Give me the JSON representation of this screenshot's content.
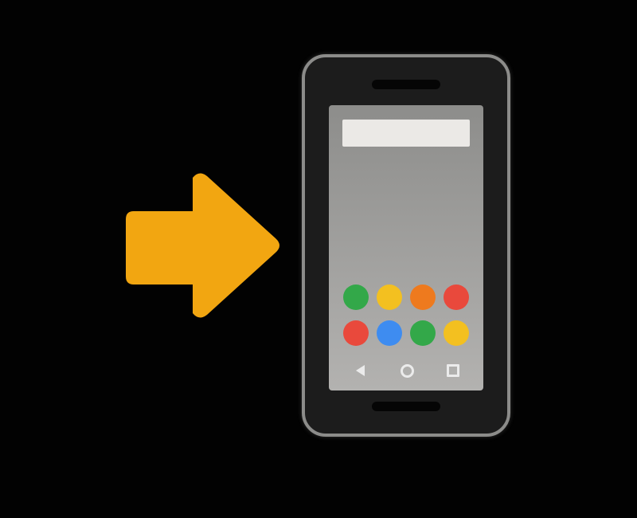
{
  "colors": {
    "background": "#020202",
    "arrow": "#F2A611",
    "phone_frame": "#8c8c8a",
    "phone_body": "#1c1c1c",
    "screen": "#a0a09e",
    "search_bar": "#ebe9e6",
    "nav_buttons": "#ebebeb"
  },
  "icons": {
    "arrow": "arrow-right-icon",
    "phone": "mobile-phone-icon"
  },
  "app_dots": [
    {
      "color": "#33A849",
      "row": 1,
      "col": 1
    },
    {
      "color": "#F3C020",
      "row": 1,
      "col": 2
    },
    {
      "color": "#EE7A1E",
      "row": 1,
      "col": 3
    },
    {
      "color": "#E9493C",
      "row": 1,
      "col": 4
    },
    {
      "color": "#E9493C",
      "row": 2,
      "col": 1
    },
    {
      "color": "#3E8CF0",
      "row": 2,
      "col": 2
    },
    {
      "color": "#33A849",
      "row": 2,
      "col": 3
    },
    {
      "color": "#F3C020",
      "row": 2,
      "col": 4
    }
  ],
  "nav_buttons": [
    "back",
    "home",
    "recents"
  ]
}
